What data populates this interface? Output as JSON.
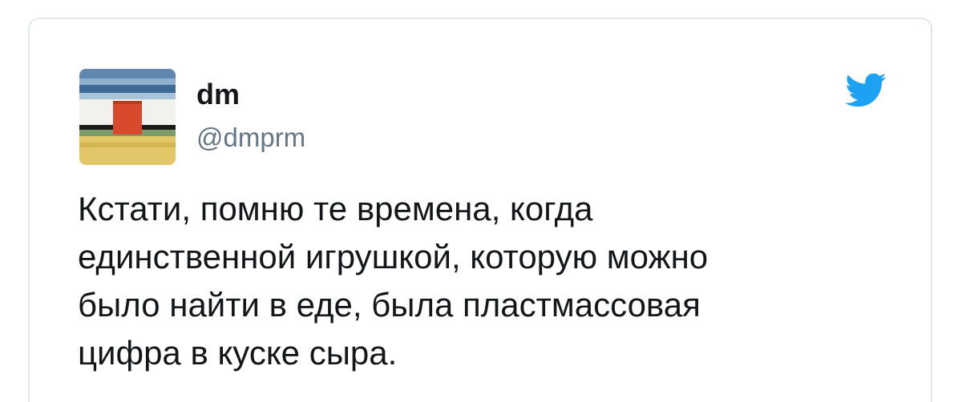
{
  "tweet": {
    "author": {
      "display_name": "dm",
      "handle": "@dmprm",
      "avatar_icon": "painting-avatar-icon"
    },
    "brand_icon": "twitter-bird-icon",
    "brand_color": "#1da1f2",
    "text_lines": [
      "Кстати, помню те времена, когда",
      "единственной игрушкой, которую можно",
      "было найти в еде, была пластмассовая",
      "цифра в куске сыра."
    ]
  }
}
